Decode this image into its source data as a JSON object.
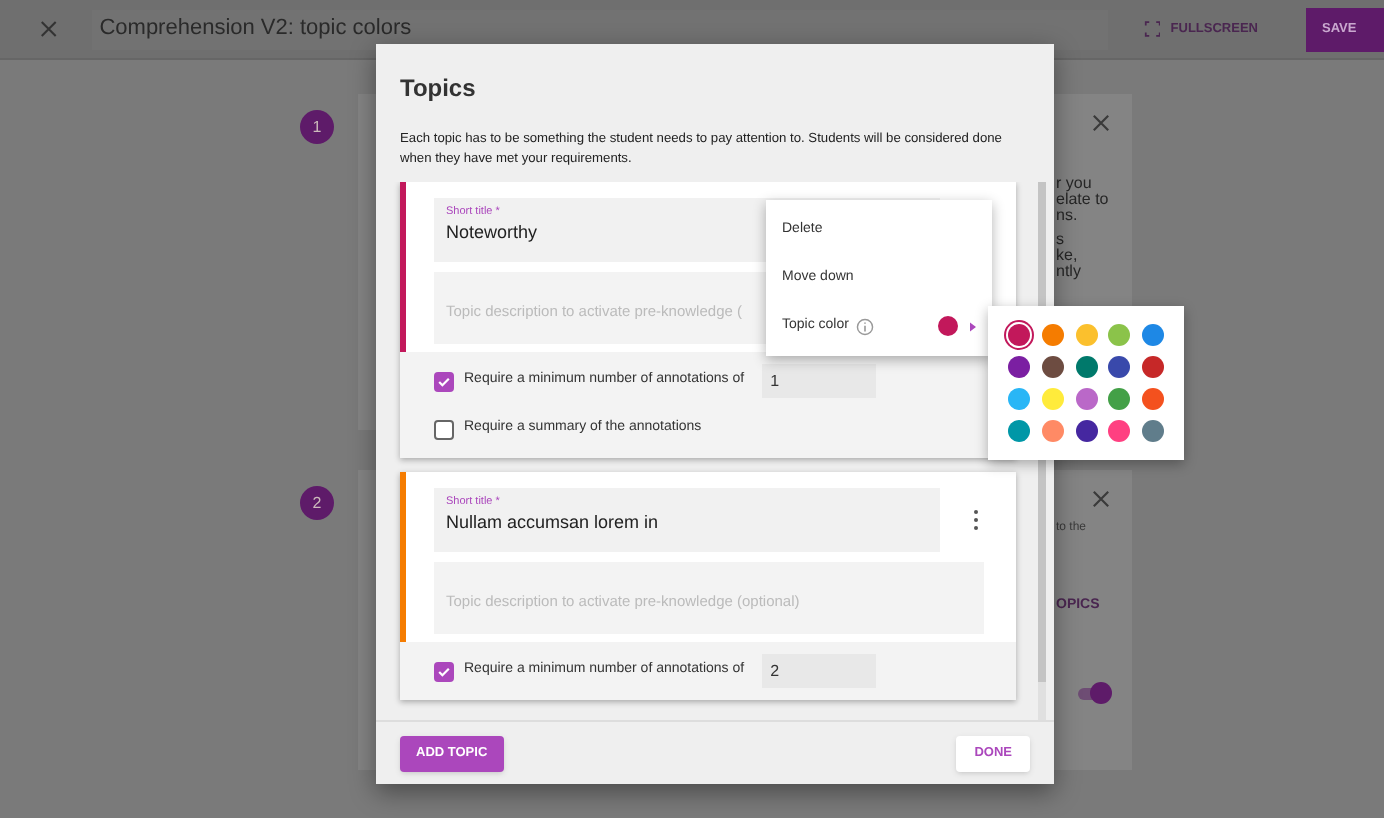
{
  "top_bar": {
    "title": "Comprehension V2: topic colors",
    "fullscreen": "FULLSCREEN",
    "save": "SAVE"
  },
  "background_steps": [
    {
      "number": "1",
      "paragraphs": [
        [
          "r you",
          "elate to",
          "ns."
        ],
        [
          "s",
          "ke,",
          "ntly"
        ]
      ]
    },
    {
      "number": "2",
      "paragraphs": [
        [
          "to the"
        ]
      ],
      "link": "OPICS",
      "toggle_on": true
    }
  ],
  "dialog": {
    "title": "Topics",
    "description": "Each topic has to be something the student needs to pay attention to. Students will be considered done when they have met your requirements.",
    "topics": [
      {
        "color": "#c2185b",
        "title_label": "Short title *",
        "title_value": "Noteworthy",
        "description_placeholder": "Topic description to activate pre-knowledge (",
        "menu_button": false,
        "requirements": [
          {
            "kind": "count",
            "label": "Require a minimum number of annotations of",
            "checked": true,
            "value": "1"
          },
          {
            "kind": "plain",
            "label": "Require a summary of the annotations",
            "checked": false
          }
        ]
      },
      {
        "color": "#f57c00",
        "title_label": "Short title *",
        "title_value": "Nullam accumsan lorem in",
        "description_placeholder": "Topic description to activate pre-knowledge (optional)",
        "menu_button": true,
        "requirements": [
          {
            "kind": "count",
            "label": "Require a minimum number of annotations of",
            "checked": true,
            "value": "2"
          }
        ]
      }
    ],
    "add_topic": "ADD TOPIC",
    "done": "DONE"
  },
  "menu": {
    "items": [
      {
        "kind": "action",
        "label": "Delete"
      },
      {
        "kind": "action",
        "label": "Move down"
      },
      {
        "kind": "color",
        "label": "Topic color",
        "color": "#c2185b"
      }
    ]
  },
  "palette": [
    {
      "color": "#c2185b",
      "selected": true
    },
    {
      "color": "#f57c00",
      "selected": false
    },
    {
      "color": "#fbc02d",
      "selected": false
    },
    {
      "color": "#8bc34a",
      "selected": false
    },
    {
      "color": "#1e88e5",
      "selected": false
    },
    {
      "color": "#7b1fa2",
      "selected": false
    },
    {
      "color": "#6d4c41",
      "selected": false
    },
    {
      "color": "#00796b",
      "selected": false
    },
    {
      "color": "#3949ab",
      "selected": false
    },
    {
      "color": "#c62828",
      "selected": false
    },
    {
      "color": "#29b6f6",
      "selected": false
    },
    {
      "color": "#ffeb3b",
      "selected": false
    },
    {
      "color": "#ba68c8",
      "selected": false
    },
    {
      "color": "#43a047",
      "selected": false
    },
    {
      "color": "#f4511e",
      "selected": false
    },
    {
      "color": "#0097a7",
      "selected": false
    },
    {
      "color": "#ff8a65",
      "selected": false
    },
    {
      "color": "#4527a0",
      "selected": false
    },
    {
      "color": "#ff4081",
      "selected": false
    },
    {
      "color": "#607d8b",
      "selected": false
    }
  ]
}
